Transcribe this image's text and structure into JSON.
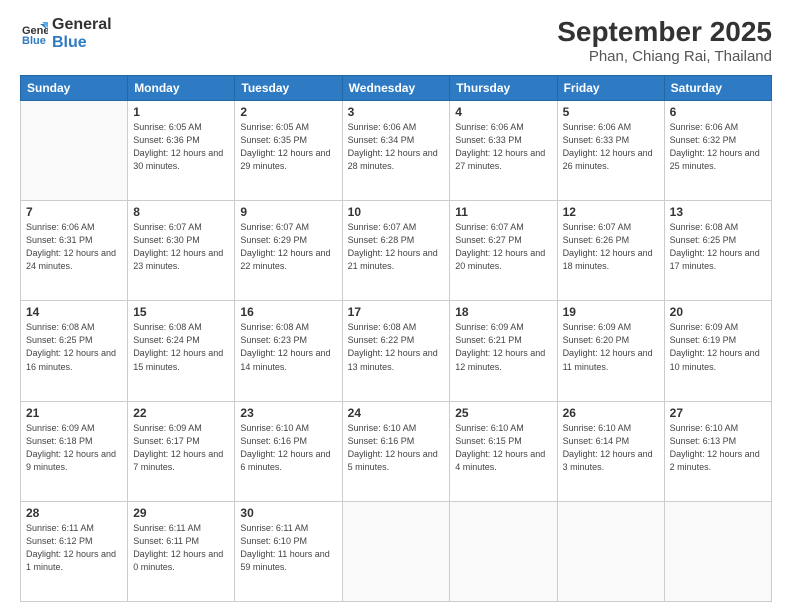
{
  "header": {
    "logo_general": "General",
    "logo_blue": "Blue",
    "title": "September 2025",
    "location": "Phan, Chiang Rai, Thailand"
  },
  "days_of_week": [
    "Sunday",
    "Monday",
    "Tuesday",
    "Wednesday",
    "Thursday",
    "Friday",
    "Saturday"
  ],
  "weeks": [
    [
      {
        "day": "",
        "info": ""
      },
      {
        "day": "1",
        "info": "Sunrise: 6:05 AM\nSunset: 6:36 PM\nDaylight: 12 hours\nand 30 minutes."
      },
      {
        "day": "2",
        "info": "Sunrise: 6:05 AM\nSunset: 6:35 PM\nDaylight: 12 hours\nand 29 minutes."
      },
      {
        "day": "3",
        "info": "Sunrise: 6:06 AM\nSunset: 6:34 PM\nDaylight: 12 hours\nand 28 minutes."
      },
      {
        "day": "4",
        "info": "Sunrise: 6:06 AM\nSunset: 6:33 PM\nDaylight: 12 hours\nand 27 minutes."
      },
      {
        "day": "5",
        "info": "Sunrise: 6:06 AM\nSunset: 6:33 PM\nDaylight: 12 hours\nand 26 minutes."
      },
      {
        "day": "6",
        "info": "Sunrise: 6:06 AM\nSunset: 6:32 PM\nDaylight: 12 hours\nand 25 minutes."
      }
    ],
    [
      {
        "day": "7",
        "info": "Sunrise: 6:06 AM\nSunset: 6:31 PM\nDaylight: 12 hours\nand 24 minutes."
      },
      {
        "day": "8",
        "info": "Sunrise: 6:07 AM\nSunset: 6:30 PM\nDaylight: 12 hours\nand 23 minutes."
      },
      {
        "day": "9",
        "info": "Sunrise: 6:07 AM\nSunset: 6:29 PM\nDaylight: 12 hours\nand 22 minutes."
      },
      {
        "day": "10",
        "info": "Sunrise: 6:07 AM\nSunset: 6:28 PM\nDaylight: 12 hours\nand 21 minutes."
      },
      {
        "day": "11",
        "info": "Sunrise: 6:07 AM\nSunset: 6:27 PM\nDaylight: 12 hours\nand 20 minutes."
      },
      {
        "day": "12",
        "info": "Sunrise: 6:07 AM\nSunset: 6:26 PM\nDaylight: 12 hours\nand 18 minutes."
      },
      {
        "day": "13",
        "info": "Sunrise: 6:08 AM\nSunset: 6:25 PM\nDaylight: 12 hours\nand 17 minutes."
      }
    ],
    [
      {
        "day": "14",
        "info": "Sunrise: 6:08 AM\nSunset: 6:25 PM\nDaylight: 12 hours\nand 16 minutes."
      },
      {
        "day": "15",
        "info": "Sunrise: 6:08 AM\nSunset: 6:24 PM\nDaylight: 12 hours\nand 15 minutes."
      },
      {
        "day": "16",
        "info": "Sunrise: 6:08 AM\nSunset: 6:23 PM\nDaylight: 12 hours\nand 14 minutes."
      },
      {
        "day": "17",
        "info": "Sunrise: 6:08 AM\nSunset: 6:22 PM\nDaylight: 12 hours\nand 13 minutes."
      },
      {
        "day": "18",
        "info": "Sunrise: 6:09 AM\nSunset: 6:21 PM\nDaylight: 12 hours\nand 12 minutes."
      },
      {
        "day": "19",
        "info": "Sunrise: 6:09 AM\nSunset: 6:20 PM\nDaylight: 12 hours\nand 11 minutes."
      },
      {
        "day": "20",
        "info": "Sunrise: 6:09 AM\nSunset: 6:19 PM\nDaylight: 12 hours\nand 10 minutes."
      }
    ],
    [
      {
        "day": "21",
        "info": "Sunrise: 6:09 AM\nSunset: 6:18 PM\nDaylight: 12 hours\nand 9 minutes."
      },
      {
        "day": "22",
        "info": "Sunrise: 6:09 AM\nSunset: 6:17 PM\nDaylight: 12 hours\nand 7 minutes."
      },
      {
        "day": "23",
        "info": "Sunrise: 6:10 AM\nSunset: 6:16 PM\nDaylight: 12 hours\nand 6 minutes."
      },
      {
        "day": "24",
        "info": "Sunrise: 6:10 AM\nSunset: 6:16 PM\nDaylight: 12 hours\nand 5 minutes."
      },
      {
        "day": "25",
        "info": "Sunrise: 6:10 AM\nSunset: 6:15 PM\nDaylight: 12 hours\nand 4 minutes."
      },
      {
        "day": "26",
        "info": "Sunrise: 6:10 AM\nSunset: 6:14 PM\nDaylight: 12 hours\nand 3 minutes."
      },
      {
        "day": "27",
        "info": "Sunrise: 6:10 AM\nSunset: 6:13 PM\nDaylight: 12 hours\nand 2 minutes."
      }
    ],
    [
      {
        "day": "28",
        "info": "Sunrise: 6:11 AM\nSunset: 6:12 PM\nDaylight: 12 hours\nand 1 minute."
      },
      {
        "day": "29",
        "info": "Sunrise: 6:11 AM\nSunset: 6:11 PM\nDaylight: 12 hours\nand 0 minutes."
      },
      {
        "day": "30",
        "info": "Sunrise: 6:11 AM\nSunset: 6:10 PM\nDaylight: 11 hours\nand 59 minutes."
      },
      {
        "day": "",
        "info": ""
      },
      {
        "day": "",
        "info": ""
      },
      {
        "day": "",
        "info": ""
      },
      {
        "day": "",
        "info": ""
      }
    ]
  ]
}
